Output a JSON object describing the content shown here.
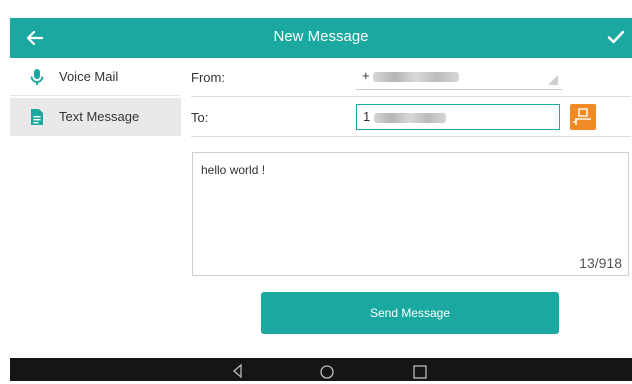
{
  "header": {
    "title": "New Message",
    "back_icon": "arrow-left-icon",
    "confirm_icon": "check-icon"
  },
  "sidebar": {
    "items": [
      {
        "label": "Voice Mail",
        "icon": "microphone-icon",
        "selected": false
      },
      {
        "label": "Text Message",
        "icon": "document-icon",
        "selected": true
      }
    ]
  },
  "form": {
    "from": {
      "label": "From:",
      "value": "+"
    },
    "to": {
      "label": "To:",
      "value": "1"
    }
  },
  "message": {
    "text": "hello world !",
    "char_count": "13/918"
  },
  "send_button": {
    "label": "Send Message"
  },
  "colors": {
    "accent": "#1aa8a1",
    "contact_button": "#f08a24",
    "nav_bar": "#151515"
  }
}
